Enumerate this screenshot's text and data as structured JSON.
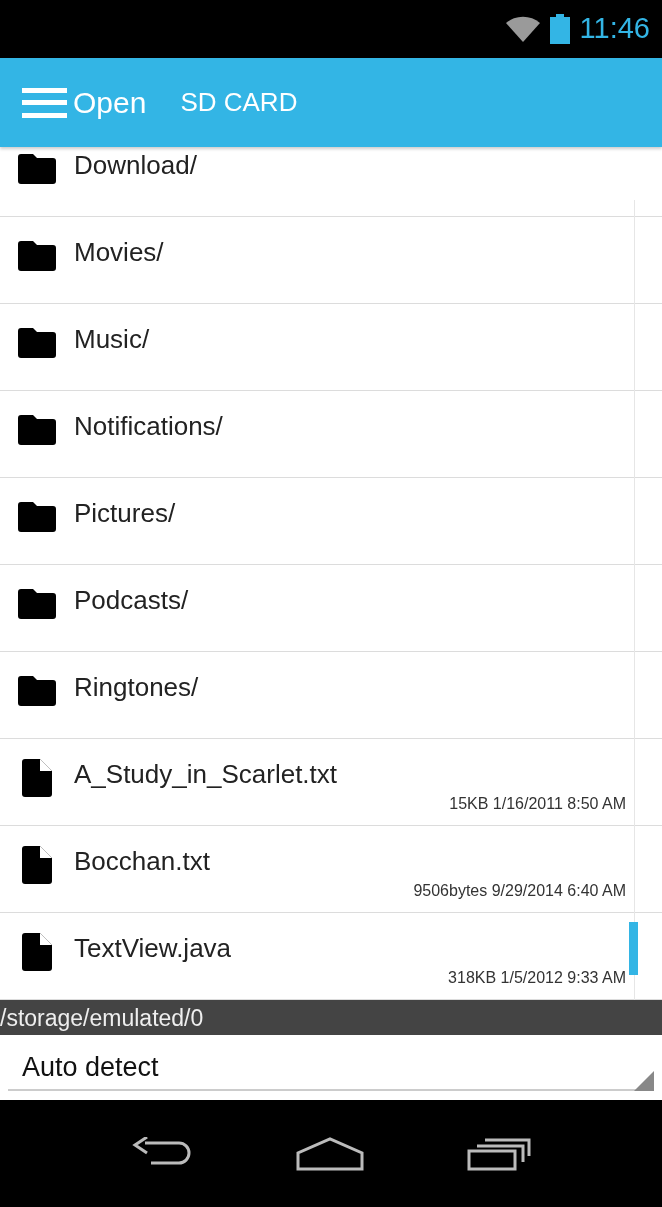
{
  "status_bar": {
    "time": "11:46"
  },
  "action_bar": {
    "title": "Open",
    "location": "SD CARD"
  },
  "files": [
    {
      "kind": "folder",
      "name": "Download/"
    },
    {
      "kind": "folder",
      "name": "Movies/"
    },
    {
      "kind": "folder",
      "name": "Music/"
    },
    {
      "kind": "folder",
      "name": "Notifications/"
    },
    {
      "kind": "folder",
      "name": "Pictures/"
    },
    {
      "kind": "folder",
      "name": "Podcasts/"
    },
    {
      "kind": "folder",
      "name": "Ringtones/"
    },
    {
      "kind": "file",
      "name": "A_Study_in_Scarlet.txt",
      "details": "15KB 1/16/2011 8:50 AM"
    },
    {
      "kind": "file",
      "name": "Bocchan.txt",
      "details": "9506bytes 9/29/2014 6:40 AM"
    },
    {
      "kind": "file",
      "name": "TextView.java",
      "details": "318KB 1/5/2012 9:33 AM"
    }
  ],
  "path": "/storage/emulated/0",
  "encoding": {
    "value": "Auto detect"
  }
}
